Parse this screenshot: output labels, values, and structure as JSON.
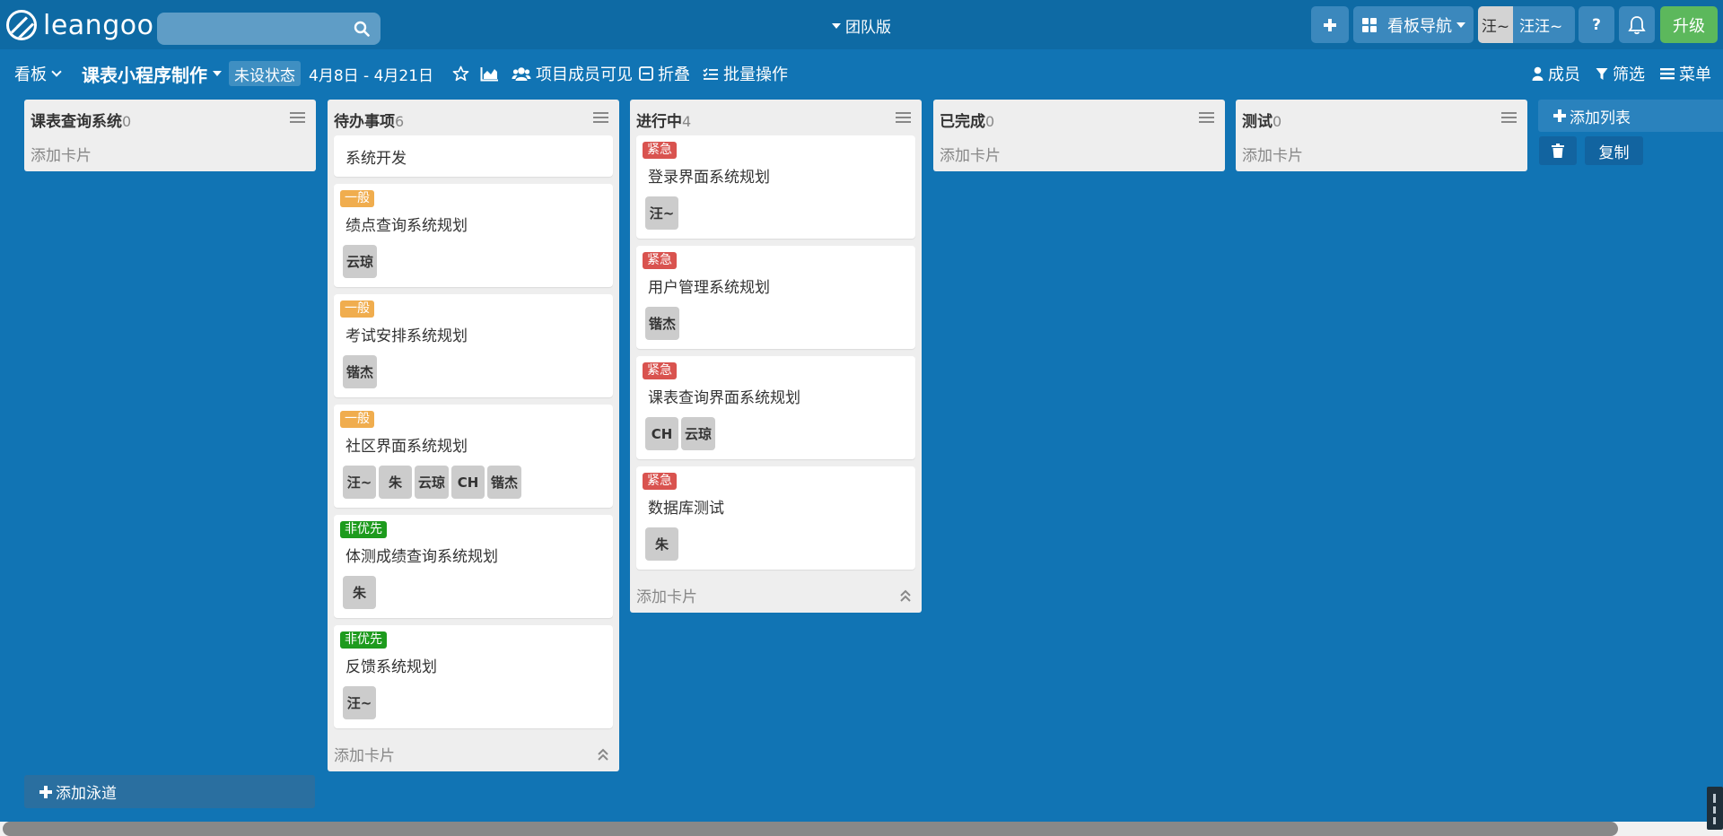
{
  "nav": {
    "logo_text": "leangoo",
    "search_placeholder": "",
    "team_edition": "团队版",
    "board_nav_label": "看板导航",
    "user_avatar": "汪~",
    "user_name": "汪汪~",
    "help_label": "?",
    "upgrade_label": "升级"
  },
  "board": {
    "tab_label": "看板",
    "title": "课表小程序制作",
    "status": "未设状态",
    "dates": "4月8日 - 4月21日",
    "members_visible": "项目成员可见",
    "collapse": "折叠",
    "batch": "批量操作",
    "members": "成员",
    "filter": "筛选",
    "menu": "菜单"
  },
  "lists": [
    {
      "title": "课表查询系统",
      "count": "0",
      "add_card": "添加卡片",
      "cards": []
    },
    {
      "title": "待办事项",
      "count": "6",
      "add_card": "添加卡片",
      "cards": [
        {
          "tag": "",
          "tag_type": "",
          "title": "系统开发",
          "assignees": []
        },
        {
          "tag": "一般",
          "tag_type": "normal",
          "title": "绩点查询系统规划",
          "assignees": [
            "云琼"
          ]
        },
        {
          "tag": "一般",
          "tag_type": "normal",
          "title": "考试安排系统规划",
          "assignees": [
            "锴杰"
          ]
        },
        {
          "tag": "一般",
          "tag_type": "normal",
          "title": "社区界面系统规划",
          "assignees": [
            "汪~",
            "朱",
            "云琼",
            "CH",
            "锴杰"
          ]
        },
        {
          "tag": "非优先",
          "tag_type": "low",
          "title": "体测成绩查询系统规划",
          "assignees": [
            "朱"
          ]
        },
        {
          "tag": "非优先",
          "tag_type": "low",
          "title": "反馈系统规划",
          "assignees": [
            "汪~"
          ]
        }
      ]
    },
    {
      "title": "进行中",
      "count": "4",
      "add_card": "添加卡片",
      "cards": [
        {
          "tag": "紧急",
          "tag_type": "urgent",
          "title": "登录界面系统规划",
          "assignees": [
            "汪~"
          ]
        },
        {
          "tag": "紧急",
          "tag_type": "urgent",
          "title": "用户管理系统规划",
          "assignees": [
            "锴杰"
          ]
        },
        {
          "tag": "紧急",
          "tag_type": "urgent",
          "title": "课表查询界面系统规划",
          "assignees": [
            "CH",
            "云琼"
          ]
        },
        {
          "tag": "紧急",
          "tag_type": "urgent",
          "title": "数据库测试",
          "assignees": [
            "朱"
          ]
        }
      ]
    },
    {
      "title": "已完成",
      "count": "0",
      "add_card": "添加卡片",
      "cards": []
    },
    {
      "title": "测试",
      "count": "0",
      "add_card": "添加卡片",
      "cards": []
    }
  ],
  "actions": {
    "add_list": "添加列表",
    "copy": "复制",
    "add_lane": "添加泳道"
  },
  "colors": {
    "background": "#1174b4",
    "tag_normal": "#f0ad4e",
    "tag_urgent": "#d9534f",
    "tag_low": "#1d9b1d",
    "upgrade": "#5cb85c"
  }
}
